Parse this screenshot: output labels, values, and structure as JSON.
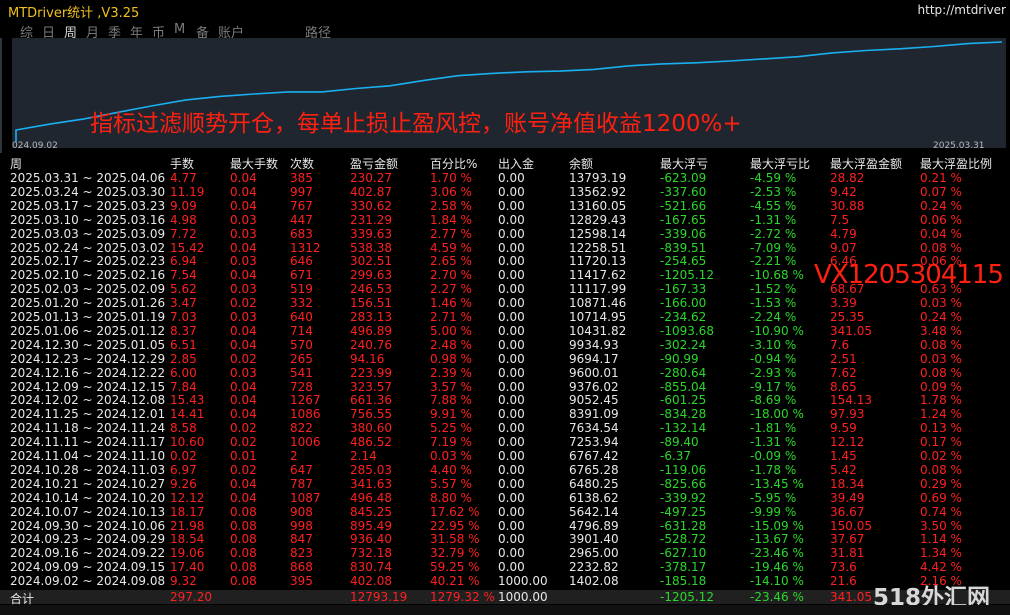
{
  "app": {
    "title": "MTDriver统计 ,V3.25",
    "url": "http://mtdriver"
  },
  "tabs": [
    {
      "label": "综",
      "active": false
    },
    {
      "label": "日",
      "active": false
    },
    {
      "label": "周",
      "active": true
    },
    {
      "label": "月",
      "active": false
    },
    {
      "label": "季",
      "active": false
    },
    {
      "label": "年",
      "active": false
    },
    {
      "label": "币",
      "active": false
    },
    {
      "label": "M",
      "active": false
    },
    {
      "label": "备",
      "active": false
    },
    {
      "label": "账户",
      "active": false
    },
    {
      "label": "路径",
      "active": false
    }
  ],
  "chart": {
    "start_label": "024.09.02",
    "end_label": "2025.03.31",
    "line_color": "#1ab0f0",
    "balance": [
      1402.08,
      2232.82,
      2965.0,
      3901.4,
      4796.89,
      5642.14,
      6138.62,
      6480.25,
      6765.28,
      6767.42,
      7253.94,
      7634.54,
      8391.09,
      9052.45,
      9376.02,
      9600.01,
      9694.17,
      9934.93,
      10431.82,
      10714.95,
      10871.46,
      11117.99,
      11417.62,
      11720.13,
      12258.51,
      12598.14,
      12829.43,
      13160.05,
      13562.92,
      13793.19
    ]
  },
  "overlay_text": "指标过滤顺势开仓，每单止损止盈风控，账号净值收益1200%+",
  "watermark": "VX1205304115",
  "logo_text": "518外汇网",
  "columns": [
    "周",
    "手数",
    "最大手数",
    "次数",
    "盈亏金额",
    "百分比%",
    "出入金",
    "余额",
    "最大浮亏",
    "最大浮亏比",
    "最大浮盈金额",
    "最大浮盈比例"
  ],
  "rows": [
    [
      "2025.03.31 ~ 2025.04.06",
      "4.77",
      "0.04",
      "385",
      "230.27",
      "1.70 %",
      "0.00",
      "13793.19",
      "-623.09",
      "-4.59 %",
      "28.82",
      "0.21 %"
    ],
    [
      "2025.03.24 ~ 2025.03.30",
      "11.19",
      "0.04",
      "997",
      "402.87",
      "3.06 %",
      "0.00",
      "13562.92",
      "-337.60",
      "-2.53 %",
      "9.42",
      "0.07 %"
    ],
    [
      "2025.03.17 ~ 2025.03.23",
      "9.09",
      "0.04",
      "767",
      "330.62",
      "2.58 %",
      "0.00",
      "13160.05",
      "-521.66",
      "-4.55 %",
      "30.88",
      "0.24 %"
    ],
    [
      "2025.03.10 ~ 2025.03.16",
      "4.98",
      "0.03",
      "447",
      "231.29",
      "1.84 %",
      "0.00",
      "12829.43",
      "-167.65",
      "-1.31 %",
      "7.5",
      "0.06 %"
    ],
    [
      "2025.03.03 ~ 2025.03.09",
      "7.72",
      "0.03",
      "683",
      "339.63",
      "2.77 %",
      "0.00",
      "12598.14",
      "-339.06",
      "-2.72 %",
      "4.79",
      "0.04 %"
    ],
    [
      "2025.02.24 ~ 2025.03.02",
      "15.42",
      "0.04",
      "1312",
      "538.38",
      "4.59 %",
      "0.00",
      "12258.51",
      "-839.51",
      "-7.09 %",
      "9.07",
      "0.08 %"
    ],
    [
      "2025.02.17 ~ 2025.02.23",
      "6.94",
      "0.03",
      "646",
      "302.51",
      "2.65 %",
      "0.00",
      "11720.13",
      "-254.65",
      "-2.21 %",
      "6.46",
      "0.06 %"
    ],
    [
      "2025.02.10 ~ 2025.02.16",
      "7.54",
      "0.04",
      "671",
      "299.63",
      "2.70 %",
      "0.00",
      "11417.62",
      "-1205.12",
      "-10.68 %",
      "",
      ""
    ],
    [
      "2025.02.03 ~ 2025.02.09",
      "5.62",
      "0.03",
      "519",
      "246.53",
      "2.27 %",
      "0.00",
      "11117.99",
      "-167.33",
      "-1.52 %",
      "68.67",
      "0.63 %"
    ],
    [
      "2025.01.20 ~ 2025.01.26",
      "3.47",
      "0.02",
      "332",
      "156.51",
      "1.46 %",
      "0.00",
      "10871.46",
      "-166.00",
      "-1.53 %",
      "3.39",
      "0.03 %"
    ],
    [
      "2025.01.13 ~ 2025.01.19",
      "7.03",
      "0.03",
      "640",
      "283.13",
      "2.71 %",
      "0.00",
      "10714.95",
      "-234.62",
      "-2.24 %",
      "25.35",
      "0.24 %"
    ],
    [
      "2025.01.06 ~ 2025.01.12",
      "8.37",
      "0.04",
      "714",
      "496.89",
      "5.00 %",
      "0.00",
      "10431.82",
      "-1093.68",
      "-10.90 %",
      "341.05",
      "3.48 %"
    ],
    [
      "2024.12.30 ~ 2025.01.05",
      "6.51",
      "0.04",
      "570",
      "240.76",
      "2.48 %",
      "0.00",
      "9934.93",
      "-302.24",
      "-3.10 %",
      "7.6",
      "0.08 %"
    ],
    [
      "2024.12.23 ~ 2024.12.29",
      "2.85",
      "0.02",
      "265",
      "94.16",
      "0.98 %",
      "0.00",
      "9694.17",
      "-90.99",
      "-0.94 %",
      "2.51",
      "0.03 %"
    ],
    [
      "2024.12.16 ~ 2024.12.22",
      "6.00",
      "0.03",
      "541",
      "223.99",
      "2.39 %",
      "0.00",
      "9600.01",
      "-280.64",
      "-2.93 %",
      "7.62",
      "0.08 %"
    ],
    [
      "2024.12.09 ~ 2024.12.15",
      "7.84",
      "0.04",
      "728",
      "323.57",
      "3.57 %",
      "0.00",
      "9376.02",
      "-855.04",
      "-9.17 %",
      "8.65",
      "0.09 %"
    ],
    [
      "2024.12.02 ~ 2024.12.08",
      "15.43",
      "0.04",
      "1267",
      "661.36",
      "7.88 %",
      "0.00",
      "9052.45",
      "-601.25",
      "-8.69 %",
      "154.13",
      "1.78 %"
    ],
    [
      "2024.11.25 ~ 2024.12.01",
      "14.41",
      "0.04",
      "1086",
      "756.55",
      "9.91 %",
      "0.00",
      "8391.09",
      "-834.28",
      "-18.00 %",
      "97.93",
      "1.24 %"
    ],
    [
      "2024.11.18 ~ 2024.11.24",
      "8.58",
      "0.02",
      "822",
      "380.60",
      "5.25 %",
      "0.00",
      "7634.54",
      "-132.14",
      "-1.81 %",
      "9.59",
      "0.13 %"
    ],
    [
      "2024.11.11 ~ 2024.11.17",
      "10.60",
      "0.02",
      "1006",
      "486.52",
      "7.19 %",
      "0.00",
      "7253.94",
      "-89.40",
      "-1.31 %",
      "12.12",
      "0.17 %"
    ],
    [
      "2024.11.04 ~ 2024.11.10",
      "0.02",
      "0.01",
      "2",
      "2.14",
      "0.03 %",
      "0.00",
      "6767.42",
      "-6.37",
      "-0.09 %",
      "1.45",
      "0.02 %"
    ],
    [
      "2024.10.28 ~ 2024.11.03",
      "6.97",
      "0.02",
      "647",
      "285.03",
      "4.40 %",
      "0.00",
      "6765.28",
      "-119.06",
      "-1.78 %",
      "5.42",
      "0.08 %"
    ],
    [
      "2024.10.21 ~ 2024.10.27",
      "9.26",
      "0.04",
      "787",
      "341.63",
      "5.57 %",
      "0.00",
      "6480.25",
      "-825.66",
      "-13.45 %",
      "18.34",
      "0.29 %"
    ],
    [
      "2024.10.14 ~ 2024.10.20",
      "12.12",
      "0.04",
      "1087",
      "496.48",
      "8.80 %",
      "0.00",
      "6138.62",
      "-339.92",
      "-5.95 %",
      "39.49",
      "0.69 %"
    ],
    [
      "2024.10.07 ~ 2024.10.13",
      "18.17",
      "0.08",
      "908",
      "845.25",
      "17.62 %",
      "0.00",
      "5642.14",
      "-497.25",
      "-9.99 %",
      "36.67",
      "0.74 %"
    ],
    [
      "2024.09.30 ~ 2024.10.06",
      "21.98",
      "0.08",
      "998",
      "895.49",
      "22.95 %",
      "0.00",
      "4796.89",
      "-631.28",
      "-15.09 %",
      "150.05",
      "3.50 %"
    ],
    [
      "2024.09.23 ~ 2024.09.29",
      "18.54",
      "0.08",
      "847",
      "936.40",
      "31.58 %",
      "0.00",
      "3901.40",
      "-528.72",
      "-13.67 %",
      "37.67",
      "1.14 %"
    ],
    [
      "2024.09.16 ~ 2024.09.22",
      "19.06",
      "0.08",
      "823",
      "732.18",
      "32.79 %",
      "0.00",
      "2965.00",
      "-627.10",
      "-23.46 %",
      "31.81",
      "1.34 %"
    ],
    [
      "2024.09.09 ~ 2024.09.15",
      "17.40",
      "0.08",
      "868",
      "830.74",
      "59.25 %",
      "0.00",
      "2232.82",
      "-378.17",
      "-19.46 %",
      "73.6",
      "4.42 %"
    ],
    [
      "2024.09.02 ~ 2024.09.08",
      "9.32",
      "0.08",
      "395",
      "402.08",
      "40.21 %",
      "1000.00",
      "1402.08",
      "-185.18",
      "-14.10 %",
      "21.6",
      "2.16 %"
    ]
  ],
  "total": [
    "合计",
    "297.20",
    "",
    "",
    "12793.19",
    "1279.32 %",
    "1000.00",
    "",
    "-1205.12",
    "-23.46 %",
    "341.05",
    ""
  ]
}
